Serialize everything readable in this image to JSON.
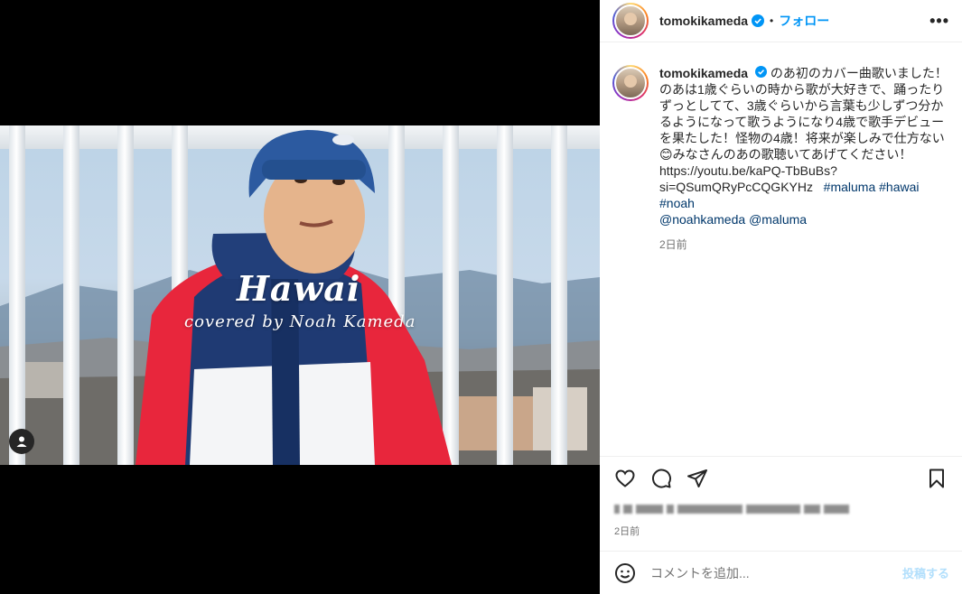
{
  "post": {
    "video_overlay": {
      "title": "Hawai",
      "subtitle": "covered by Noah Kameda"
    },
    "header": {
      "username": "tomokikameda",
      "separator": "•",
      "follow_label": "フォロー",
      "more_label": "•••"
    },
    "caption": {
      "username": "tomokikameda",
      "text_lines": [
        "のあ初のカバー曲歌いました！",
        "のあは1歳ぐらいの時から歌が大好きで、踊ったり",
        "ずっとしてて、3歳ぐらいから言葉も少しずつ分か",
        "るようになって歌うようになり4歳で歌手デビュー",
        "を果たした！怪物の4歳！将来が楽しみで仕方ない",
        "😊みなさんのあの歌聴いてあげてください！"
      ],
      "link_line1": "https://youtu.be/kaPQ-TbBuBs?",
      "link_line2": "si=QSumQRyPcCQGKYHz",
      "hashtags": [
        "#maluma",
        "#hawai",
        "#noah"
      ],
      "mentions": [
        "@noahkameda",
        "@maluma"
      ],
      "time": "2日前"
    },
    "actions": {
      "like_icon": "heart-icon",
      "comment_icon": "comment-icon",
      "share_icon": "paper-plane-icon",
      "save_icon": "bookmark-icon"
    },
    "post_time": "2日前",
    "comment": {
      "placeholder": "コメントを追加...",
      "post_label": "投稿する",
      "emoji_icon": "smiley-icon"
    },
    "colors": {
      "link_blue": "#0095f6",
      "hashtag": "#00376b",
      "verified": "#0095f6",
      "muted": "#737373"
    }
  }
}
